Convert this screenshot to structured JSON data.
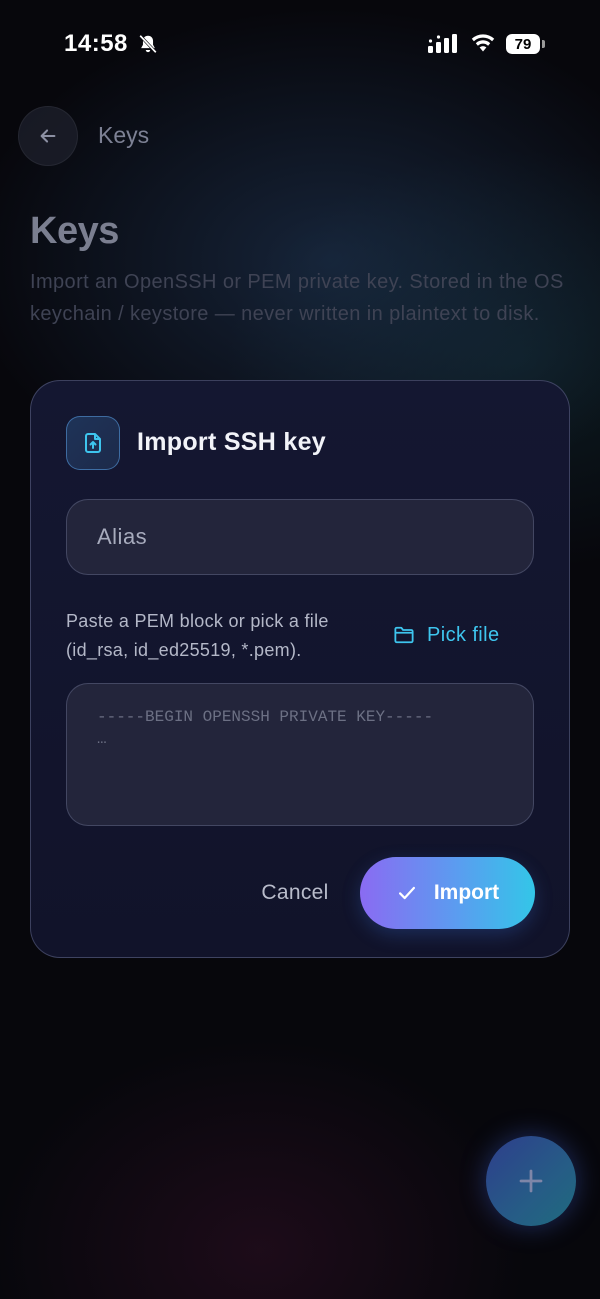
{
  "status_bar": {
    "time": "14:58",
    "battery": "79",
    "icons": [
      "bell-muted-icon",
      "signal-icon",
      "wifi-icon",
      "battery-icon"
    ]
  },
  "nav": {
    "back_icon": "arrow-left-icon",
    "title": "Keys"
  },
  "header": {
    "title": "Keys",
    "description": "Import an OpenSSH or PEM private key. Stored in the OS keychain / keystore — never written in plaintext to disk."
  },
  "card": {
    "icon": "file-upload-icon",
    "title": "Import SSH key",
    "alias": {
      "value": "",
      "placeholder": "Alias"
    },
    "hint": "Paste a PEM block or pick a file (id_rsa, id_ed25519, *.pem).",
    "pick_file": {
      "icon": "folder-icon",
      "label": "Pick file"
    },
    "pem": {
      "value": "",
      "placeholder": "-----BEGIN OPENSSH PRIVATE KEY-----\n…"
    },
    "cancel_label": "Cancel",
    "import": {
      "icon": "check-icon",
      "label": "Import"
    }
  },
  "fab": {
    "icon": "plus-icon"
  },
  "colors": {
    "accent": "#3ec5ee",
    "gradient_start": "#8a6bf2",
    "gradient_end": "#33c6e8",
    "card_bg": "#141731",
    "background": "#07070c"
  }
}
